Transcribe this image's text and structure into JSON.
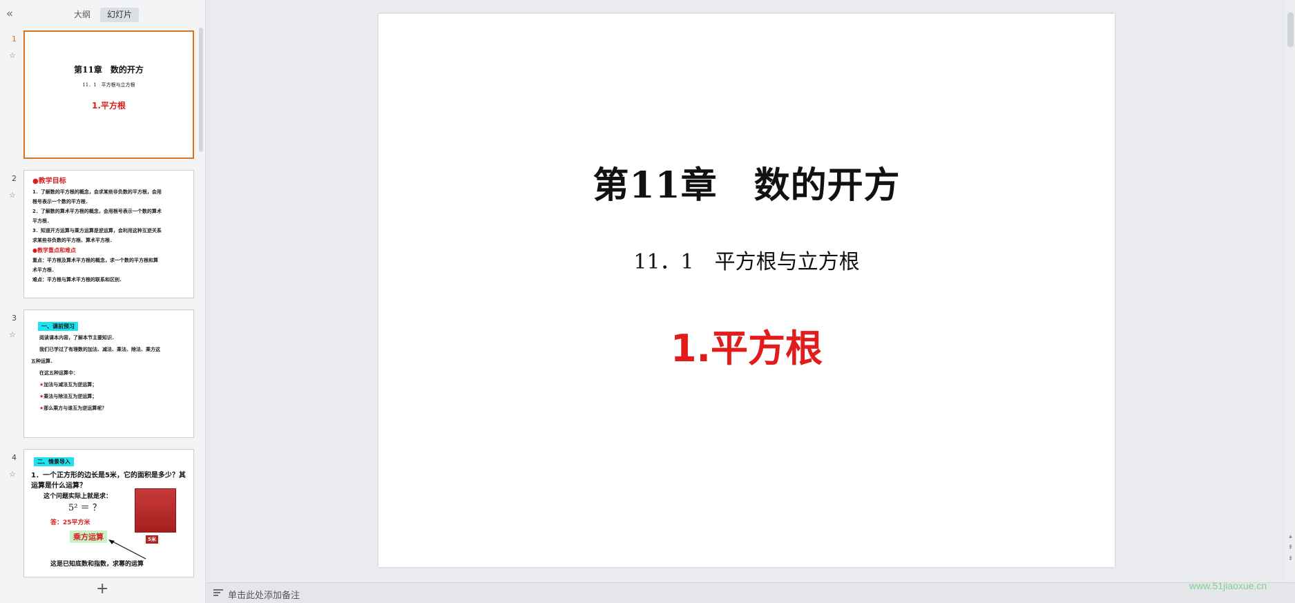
{
  "panel": {
    "collapse_icon": "«",
    "tabs": [
      {
        "label": "大纲",
        "active": false
      },
      {
        "label": "幻灯片",
        "active": true
      }
    ],
    "add_icon": "+"
  },
  "slides": [
    {
      "number": "1",
      "title": "第11章　数的开方",
      "subtitle": "11．1　平方根与立方根",
      "red": "1.平方根"
    },
    {
      "number": "2",
      "head1": "●教学目标",
      "lines1": [
        "1．了解数的平方根的概念，会求某些非负数的平方根，会用",
        "根号表示一个数的平方根．",
        "2．了解数的算术平方根的概念，会用根号表示一个数的算术",
        "平方根．",
        "3．知道开方运算与乘方运算是逆运算，会利用这种互逆关系",
        "求某些非负数的平方根、算术平方根．"
      ],
      "head2": "●教学重点和难点",
      "lines2": [
        "重点：平方根及算术平方根的概念，求一个数的平方根和算",
        "术平方根．",
        "难点：平方根与算术平方根的联系和区别．"
      ]
    },
    {
      "number": "3",
      "tag": "一、课前预习",
      "lines": [
        "阅读课本内容，了解本节主要知识．",
        "我们已学过了有理数的加法、减法、乘法、除法、乘方这",
        "五种运算．",
        "在这五种运算中："
      ],
      "star_items": [
        "加法与减法互为逆运算；",
        "乘法与除法互为逆运算；",
        "那么乘方与谁互为逆运算呢？"
      ]
    },
    {
      "number": "4",
      "tag": "二、情景导入",
      "question": "1．一个正方形的边长是5米，它的面积是多少？其运算是什么运算？",
      "line": "这个问题实际上就是求：",
      "equation": "5² ＝ ？",
      "answer": "答：25平方米",
      "green_label": "乘方运算",
      "dimension": "5米",
      "bottom": "这是已知底数和指数，求幂的运算"
    }
  ],
  "main_slide": {
    "title": "第11章　数的开方",
    "subtitle": "11．1　平方根与立方根",
    "red": "1.平方根"
  },
  "notes": {
    "placeholder": "单击此处添加备注"
  },
  "watermark": "www.51jiaoxue.cn",
  "colors": {
    "accent": "#d9721d",
    "red": "#e21b1b",
    "cyan": "#1ee3ee",
    "watermark": "#7fd08a"
  }
}
